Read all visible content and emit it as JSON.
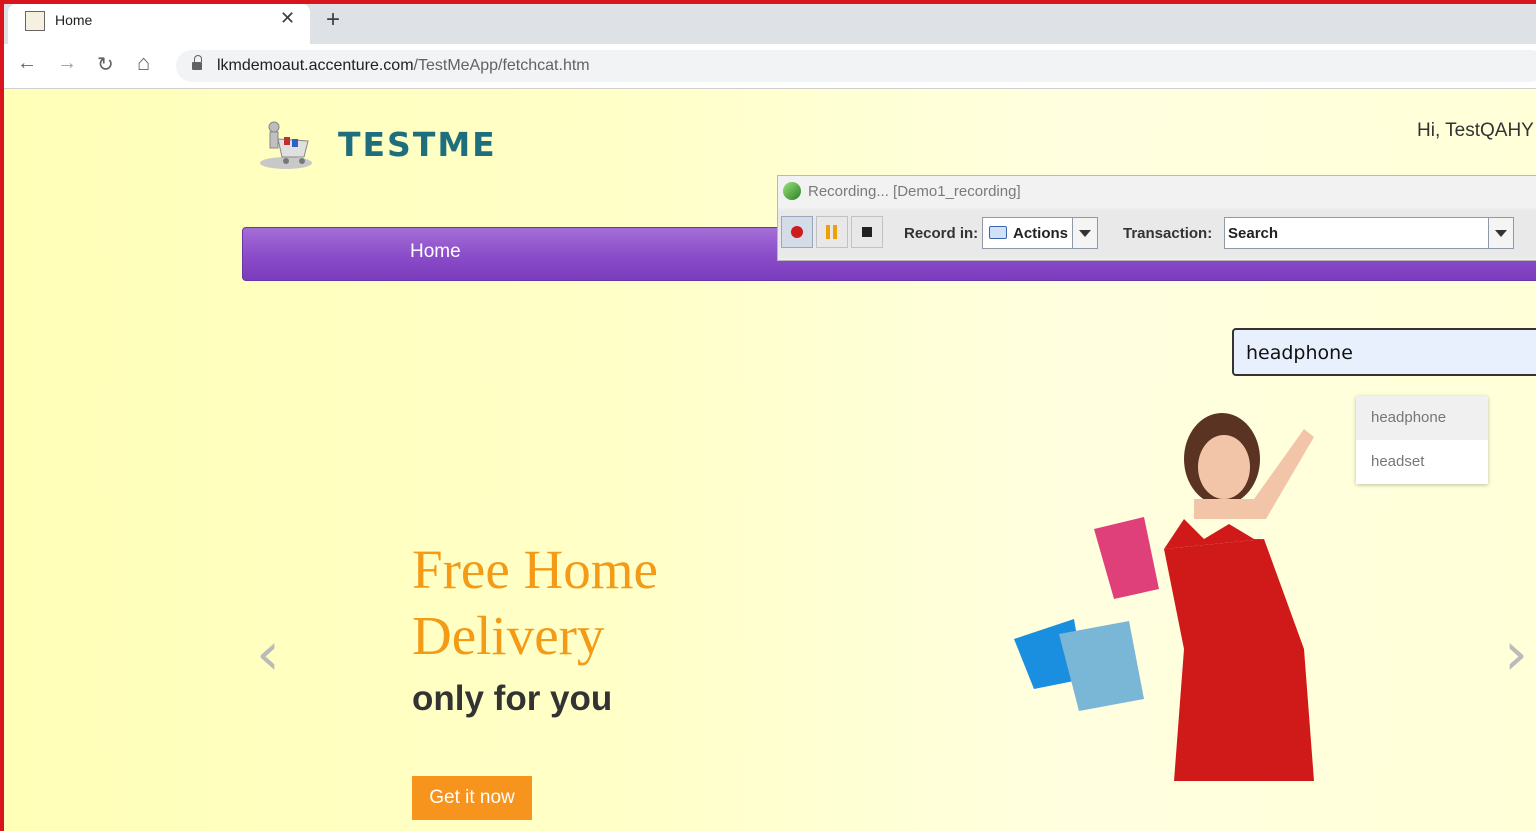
{
  "browser": {
    "tab_title": "Home",
    "tab_close": "✕",
    "new_tab": "+",
    "url_host": "lkmdemoaut.accenture.com",
    "url_path": "/TestMeApp/fetchcat.htm",
    "back": "←",
    "forward": "→",
    "reload": "↻",
    "home": "⌂"
  },
  "site": {
    "logo_text": "TESTME",
    "greeting": "Hi, TestQAHY",
    "nav_home": "Home",
    "search_value": "headphone",
    "suggestions": [
      "headphone",
      "headset"
    ]
  },
  "hero": {
    "title_line1": "Free Home",
    "title_line2": "Delivery",
    "subtitle": "only for you",
    "cta": "Get it now",
    "prev_arrow": "‹",
    "next_arrow": "›"
  },
  "recorder": {
    "title": "Recording... [Demo1_recording]",
    "record_in_label": "Record in:",
    "record_in_value": "Actions",
    "transaction_label": "Transaction:",
    "transaction_value": "Search"
  },
  "colors": {
    "recording_frame": "#d9141c",
    "nav_purple": "#8a4cc8",
    "hero_orange": "#f39a17",
    "cta_orange": "#f7941d"
  }
}
